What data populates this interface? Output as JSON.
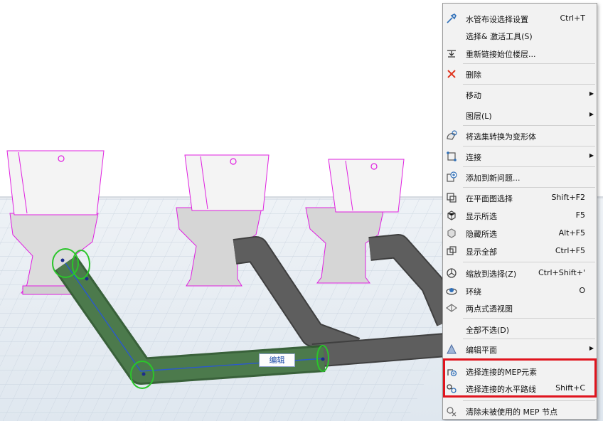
{
  "canvas": {
    "edit_tag": "编辑"
  },
  "menu": {
    "items": [
      {
        "label": "水管布设选择设置",
        "shortcut": "Ctrl+T",
        "icon": "pipe-settings-icon",
        "submenu": false
      },
      {
        "label": "选择& 激活工具(S)",
        "shortcut": "",
        "icon": "",
        "submenu": false
      },
      {
        "label": "重新链接始位楼层...",
        "shortcut": "",
        "icon": "relink-story-icon",
        "submenu": false
      },
      {
        "label": "删除",
        "shortcut": "",
        "icon": "delete-icon",
        "submenu": false
      },
      {
        "label": "移动",
        "shortcut": "",
        "icon": "",
        "submenu": true
      },
      {
        "label": "图层(L)",
        "shortcut": "",
        "icon": "",
        "submenu": true
      },
      {
        "label": "将选集转换为变形体",
        "shortcut": "",
        "icon": "morph-convert-icon",
        "submenu": false
      },
      {
        "label": "连接",
        "shortcut": "",
        "icon": "connect-icon",
        "submenu": true
      },
      {
        "label": "添加到新问题...",
        "shortcut": "",
        "icon": "add-issue-icon",
        "submenu": false
      },
      {
        "label": "在平面图选择",
        "shortcut": "Shift+F2",
        "icon": "select-in-plan-icon",
        "submenu": false
      },
      {
        "label": "显示所选",
        "shortcut": "F5",
        "icon": "show-selection-icon",
        "submenu": false
      },
      {
        "label": "隐藏所选",
        "shortcut": "Alt+F5",
        "icon": "hide-selection-icon",
        "submenu": false
      },
      {
        "label": "显示全部",
        "shortcut": "Ctrl+F5",
        "icon": "show-all-icon",
        "submenu": false
      },
      {
        "label": "缩放到选择(Z)",
        "shortcut": "Ctrl+Shift+'",
        "icon": "zoom-selection-icon",
        "submenu": false
      },
      {
        "label": "环绕",
        "shortcut": "O",
        "icon": "orbit-icon",
        "submenu": false
      },
      {
        "label": "两点式透视图",
        "shortcut": "",
        "icon": "two-point-perspective-icon",
        "submenu": false
      },
      {
        "label": "全部不选(D)",
        "shortcut": "",
        "icon": "",
        "submenu": false
      },
      {
        "label": "编辑平面",
        "shortcut": "",
        "icon": "edit-plane-icon",
        "submenu": true
      },
      {
        "label": "选择连接的MEP元素",
        "shortcut": "",
        "icon": "select-connected-mep-icon",
        "submenu": false
      },
      {
        "label": "选择连接的水平路线",
        "shortcut": "Shift+C",
        "icon": "select-horizontal-route-icon",
        "submenu": false
      },
      {
        "label": "清除未被使用的 MEP 节点",
        "shortcut": "",
        "icon": "purge-mep-nodes-icon",
        "submenu": false
      }
    ]
  },
  "colors": {
    "highlight": "#e0141e",
    "selection_green": "#2bc52b",
    "pipe_gray": "#5a5a5a",
    "fixture_outline": "#e020e0"
  }
}
